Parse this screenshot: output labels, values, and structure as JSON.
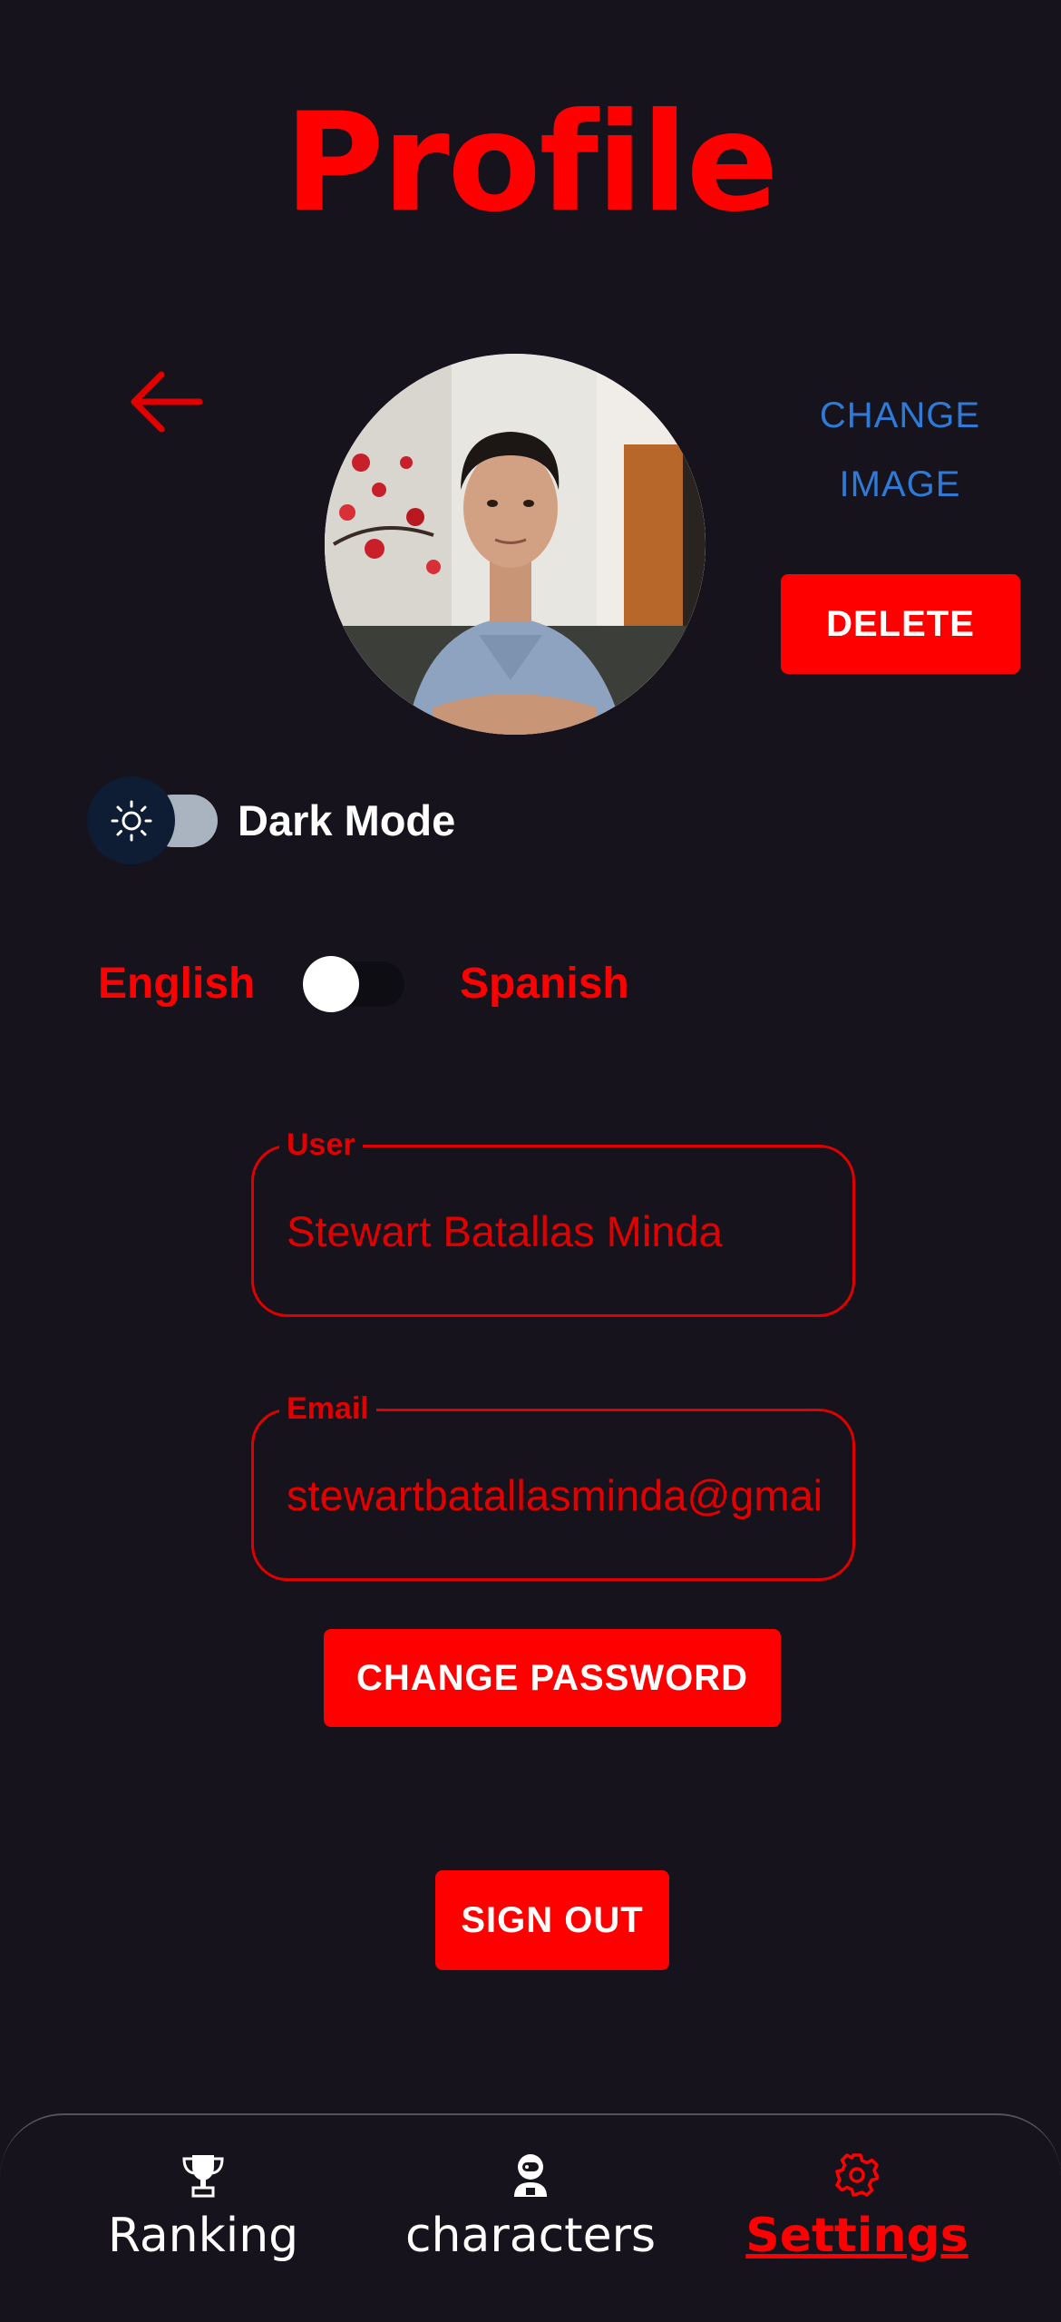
{
  "header": {
    "title": "Profile"
  },
  "profile": {
    "change_image_line1": "CHANGE",
    "change_image_line2": "IMAGE",
    "delete_label": "DELETE"
  },
  "settings": {
    "dark_mode_label": "Dark Mode",
    "dark_mode_on": false,
    "language_left": "English",
    "language_right": "Spanish",
    "language_selected": "English"
  },
  "form": {
    "user_label": "User",
    "user_value": "Stewart Batallas Minda",
    "email_label": "Email",
    "email_value": "stewartbatallasminda@gmail.com",
    "change_password_label": "CHANGE PASSWORD"
  },
  "signout_label": "SIGN OUT",
  "nav": {
    "items": [
      {
        "label": "Ranking",
        "icon": "trophy-icon",
        "active": false
      },
      {
        "label": "characters",
        "icon": "astronaut-icon",
        "active": false
      },
      {
        "label": "Settings",
        "icon": "gear-icon",
        "active": true
      }
    ]
  },
  "colors": {
    "background": "#16131d",
    "accent": "#ff0000",
    "link": "#2f7ad6",
    "nav_inactive": "#ffffff"
  }
}
